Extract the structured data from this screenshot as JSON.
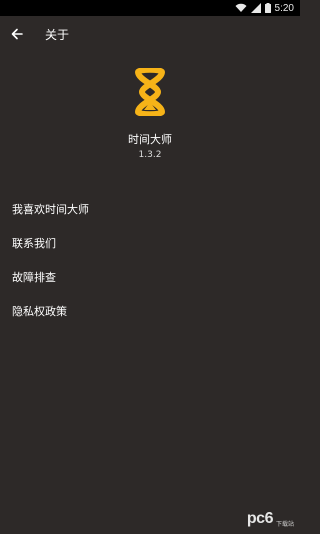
{
  "status_bar": {
    "time": "5:20"
  },
  "app_bar": {
    "title": "关于"
  },
  "about": {
    "app_name": "时间大师",
    "version": "1.3.2"
  },
  "menu": {
    "items": [
      {
        "label": "我喜欢时间大师"
      },
      {
        "label": "联系我们"
      },
      {
        "label": "故障排查"
      },
      {
        "label": "隐私权政策"
      }
    ]
  },
  "watermark": {
    "text_a": "pc",
    "text_b": "6",
    "sub": "下载站"
  },
  "colors": {
    "background": "#2d2928",
    "logo_yellow": "#f6b318",
    "status_bar": "#000000"
  }
}
